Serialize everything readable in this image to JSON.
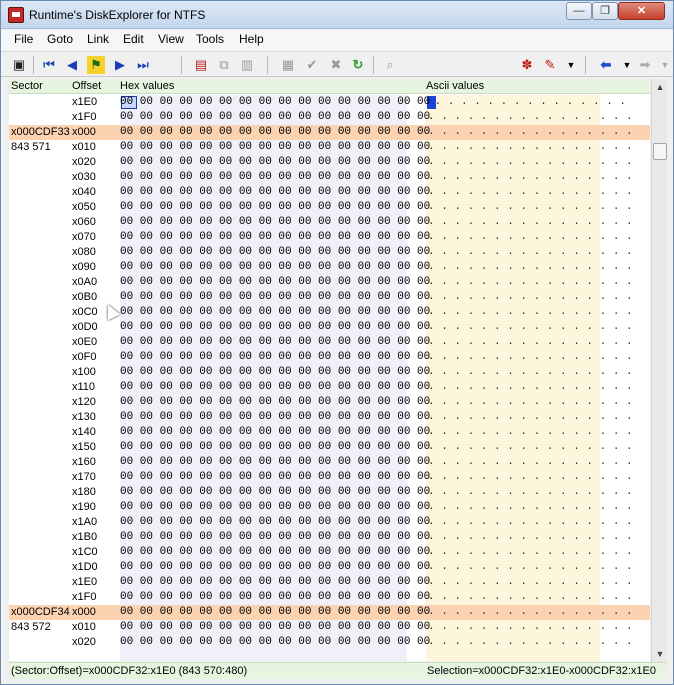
{
  "window": {
    "title": "Runtime's DiskExplorer for NTFS",
    "min_label": "—",
    "max_label": "❐",
    "close_label": "✕"
  },
  "menu": [
    "File",
    "Goto",
    "Link",
    "Edit",
    "View",
    "Tools",
    "Help"
  ],
  "toolbar": {
    "icons": [
      "save-icon",
      "first-icon",
      "prev-icon",
      "runner-icon",
      "next-icon",
      "last-icon",
      "mark-icon",
      "copy-icon",
      "paste-icon",
      "disk-icon",
      "check-icon",
      "cancel-icon",
      "refresh-icon",
      "find-icon",
      "pin-icon",
      "bookmark-icon",
      "back-arrow-icon",
      "forward-arrow-icon"
    ]
  },
  "columns": {
    "sector": "Sector",
    "offset": "Offset",
    "hex": "Hex values",
    "ascii": "Ascii values"
  },
  "rows": [
    {
      "sector": "",
      "offset": "x1E0",
      "hex": "00 00 00 00 00 00 00 00 00 00 00 00 00 00 00 00",
      "ascii": " . . . . . . . . . . . . . . .",
      "start": false
    },
    {
      "sector": "",
      "offset": "x1F0",
      "hex": "00 00 00 00 00 00 00 00 00 00 00 00 00 00 00 00",
      "ascii": ". . . . . . . . . . . . . . . .",
      "start": false
    },
    {
      "sector": "x000CDF33",
      "offset": "x000",
      "hex": "00 00 00 00 00 00 00 00 00 00 00 00 00 00 00 00",
      "ascii": ". . . . . . . . . . . . . . . .",
      "start": true
    },
    {
      "sector": "843 571",
      "offset": "x010",
      "hex": "00 00 00 00 00 00 00 00 00 00 00 00 00 00 00 00",
      "ascii": ". . . . . . . . . . . . . . . .",
      "start": false
    },
    {
      "sector": "",
      "offset": "x020",
      "hex": "00 00 00 00 00 00 00 00 00 00 00 00 00 00 00 00",
      "ascii": ". . . . . . . . . . . . . . . .",
      "start": false
    },
    {
      "sector": "",
      "offset": "x030",
      "hex": "00 00 00 00 00 00 00 00 00 00 00 00 00 00 00 00",
      "ascii": ". . . . . . . . . . . . . . . .",
      "start": false
    },
    {
      "sector": "",
      "offset": "x040",
      "hex": "00 00 00 00 00 00 00 00 00 00 00 00 00 00 00 00",
      "ascii": ". . . . . . . . . . . . . . . .",
      "start": false
    },
    {
      "sector": "",
      "offset": "x050",
      "hex": "00 00 00 00 00 00 00 00 00 00 00 00 00 00 00 00",
      "ascii": ". . . . . . . . . . . . . . . .",
      "start": false
    },
    {
      "sector": "",
      "offset": "x060",
      "hex": "00 00 00 00 00 00 00 00 00 00 00 00 00 00 00 00",
      "ascii": ". . . . . . . . . . . . . . . .",
      "start": false
    },
    {
      "sector": "",
      "offset": "x070",
      "hex": "00 00 00 00 00 00 00 00 00 00 00 00 00 00 00 00",
      "ascii": ". . . . . . . . . . . . . . . .",
      "start": false
    },
    {
      "sector": "",
      "offset": "x080",
      "hex": "00 00 00 00 00 00 00 00 00 00 00 00 00 00 00 00",
      "ascii": ". . . . . . . . . . . . . . . .",
      "start": false
    },
    {
      "sector": "",
      "offset": "x090",
      "hex": "00 00 00 00 00 00 00 00 00 00 00 00 00 00 00 00",
      "ascii": ". . . . . . . . . . . . . . . .",
      "start": false
    },
    {
      "sector": "",
      "offset": "x0A0",
      "hex": "00 00 00 00 00 00 00 00 00 00 00 00 00 00 00 00",
      "ascii": ". . . . . . . . . . . . . . . .",
      "start": false
    },
    {
      "sector": "",
      "offset": "x0B0",
      "hex": "00 00 00 00 00 00 00 00 00 00 00 00 00 00 00 00",
      "ascii": ". . . . . . . . . . . . . . . .",
      "start": false
    },
    {
      "sector": "",
      "offset": "x0C0",
      "hex": "00 00 00 00 00 00 00 00 00 00 00 00 00 00 00 00",
      "ascii": ". . . . . . . . . . . . . . . .",
      "start": false
    },
    {
      "sector": "",
      "offset": "x0D0",
      "hex": "00 00 00 00 00 00 00 00 00 00 00 00 00 00 00 00",
      "ascii": ". . . . . . . . . . . . . . . .",
      "start": false
    },
    {
      "sector": "",
      "offset": "x0E0",
      "hex": "00 00 00 00 00 00 00 00 00 00 00 00 00 00 00 00",
      "ascii": ". . . . . . . . . . . . . . . .",
      "start": false
    },
    {
      "sector": "",
      "offset": "x0F0",
      "hex": "00 00 00 00 00 00 00 00 00 00 00 00 00 00 00 00",
      "ascii": ". . . . . . . . . . . . . . . .",
      "start": false
    },
    {
      "sector": "",
      "offset": "x100",
      "hex": "00 00 00 00 00 00 00 00 00 00 00 00 00 00 00 00",
      "ascii": ". . . . . . . . . . . . . . . .",
      "start": false
    },
    {
      "sector": "",
      "offset": "x110",
      "hex": "00 00 00 00 00 00 00 00 00 00 00 00 00 00 00 00",
      "ascii": ". . . . . . . . . . . . . . . .",
      "start": false
    },
    {
      "sector": "",
      "offset": "x120",
      "hex": "00 00 00 00 00 00 00 00 00 00 00 00 00 00 00 00",
      "ascii": ". . . . . . . . . . . . . . . .",
      "start": false
    },
    {
      "sector": "",
      "offset": "x130",
      "hex": "00 00 00 00 00 00 00 00 00 00 00 00 00 00 00 00",
      "ascii": ". . . . . . . . . . . . . . . .",
      "start": false
    },
    {
      "sector": "",
      "offset": "x140",
      "hex": "00 00 00 00 00 00 00 00 00 00 00 00 00 00 00 00",
      "ascii": ". . . . . . . . . . . . . . . .",
      "start": false
    },
    {
      "sector": "",
      "offset": "x150",
      "hex": "00 00 00 00 00 00 00 00 00 00 00 00 00 00 00 00",
      "ascii": ". . . . . . . . . . . . . . . .",
      "start": false
    },
    {
      "sector": "",
      "offset": "x160",
      "hex": "00 00 00 00 00 00 00 00 00 00 00 00 00 00 00 00",
      "ascii": ". . . . . . . . . . . . . . . .",
      "start": false
    },
    {
      "sector": "",
      "offset": "x170",
      "hex": "00 00 00 00 00 00 00 00 00 00 00 00 00 00 00 00",
      "ascii": ". . . . . . . . . . . . . . . .",
      "start": false
    },
    {
      "sector": "",
      "offset": "x180",
      "hex": "00 00 00 00 00 00 00 00 00 00 00 00 00 00 00 00",
      "ascii": ". . . . . . . . . . . . . . . .",
      "start": false
    },
    {
      "sector": "",
      "offset": "x190",
      "hex": "00 00 00 00 00 00 00 00 00 00 00 00 00 00 00 00",
      "ascii": ". . . . . . . . . . . . . . . .",
      "start": false
    },
    {
      "sector": "",
      "offset": "x1A0",
      "hex": "00 00 00 00 00 00 00 00 00 00 00 00 00 00 00 00",
      "ascii": ". . . . . . . . . . . . . . . .",
      "start": false
    },
    {
      "sector": "",
      "offset": "x1B0",
      "hex": "00 00 00 00 00 00 00 00 00 00 00 00 00 00 00 00",
      "ascii": ". . . . . . . . . . . . . . . .",
      "start": false
    },
    {
      "sector": "",
      "offset": "x1C0",
      "hex": "00 00 00 00 00 00 00 00 00 00 00 00 00 00 00 00",
      "ascii": ". . . . . . . . . . . . . . . .",
      "start": false
    },
    {
      "sector": "",
      "offset": "x1D0",
      "hex": "00 00 00 00 00 00 00 00 00 00 00 00 00 00 00 00",
      "ascii": ". . . . . . . . . . . . . . . .",
      "start": false
    },
    {
      "sector": "",
      "offset": "x1E0",
      "hex": "00 00 00 00 00 00 00 00 00 00 00 00 00 00 00 00",
      "ascii": ". . . . . . . . . . . . . . . .",
      "start": false
    },
    {
      "sector": "",
      "offset": "x1F0",
      "hex": "00 00 00 00 00 00 00 00 00 00 00 00 00 00 00 00",
      "ascii": ". . . . . . . . . . . . . . . .",
      "start": false
    },
    {
      "sector": "x000CDF34",
      "offset": "x000",
      "hex": "00 00 00 00 00 00 00 00 00 00 00 00 00 00 00 00",
      "ascii": ". . . . . . . . . . . . . . . .",
      "start": true
    },
    {
      "sector": "843 572",
      "offset": "x010",
      "hex": "00 00 00 00 00 00 00 00 00 00 00 00 00 00 00 00",
      "ascii": ". . . . . . . . . . . . . . . .",
      "start": false
    },
    {
      "sector": "",
      "offset": "x020",
      "hex": "00 00 00 00 00 00 00 00 00 00 00 00 00 00 00 00",
      "ascii": ". . . . . . . . . . . . . . . .",
      "start": false
    }
  ],
  "status": {
    "left": "(Sector:Offset)=x000CDF32:x1E0 (843 570:480)",
    "right": "Selection=x000CDF32:x1E0-x000CDF32:x1E0"
  },
  "colors": {
    "sector_start_bg": "#fcd3b0",
    "header_bg": "#e7f5e0",
    "ascii_bg": "#fdf6dc",
    "selection": "#1c44d8"
  }
}
